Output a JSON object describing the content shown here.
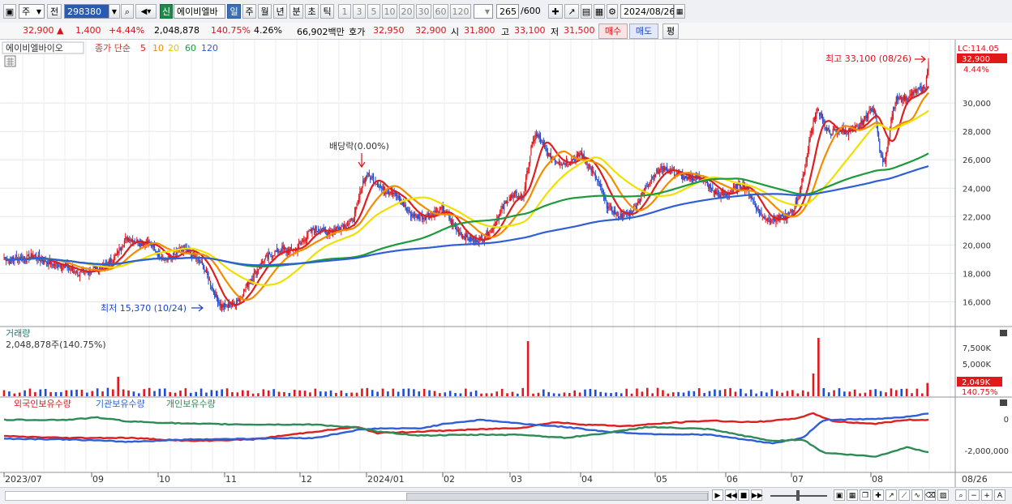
{
  "toolbar": {
    "period_type": "주",
    "prev_label": "전",
    "stock_code": "298380",
    "new_label": "신",
    "stock_name": "에이비엘바",
    "periods": [
      "일",
      "주",
      "월",
      "년",
      "분",
      "초",
      "틱"
    ],
    "intervals": [
      "1",
      "3",
      "5",
      "10",
      "20",
      "30",
      "60",
      "120"
    ],
    "count_value": "265",
    "count_total": "/600",
    "date": "2024/08/26"
  },
  "quote": {
    "price": "32,900",
    "arrow": "▲",
    "change": "1,400",
    "change_pct": "+4.44%",
    "volume": "2,048,878",
    "volume_pct": "140.75%",
    "turnover": "4.26%",
    "amount": "66,902백만",
    "bid_label": "호가",
    "ask_price": "32,950",
    "bid_price": "32,900",
    "open_label": "시",
    "open": "31,800",
    "high_label": "고",
    "high": "33,100",
    "low_label": "저",
    "low": "31,500",
    "buy_label": "매수",
    "sell_label": "매도",
    "eval_label": "평"
  },
  "price_panel": {
    "stock_label": "에이비엘바이오",
    "ma_title": "종가 단순",
    "ma_periods": [
      "5",
      "10",
      "20",
      "60",
      "120"
    ],
    "ma_colors": [
      "#dd1f1f",
      "#f28c00",
      "#f0e000",
      "#1e9a3c",
      "#2f5fd6"
    ],
    "lc_label": "LC:114.05",
    "price_tag": "32,900",
    "pct_tag": "4.44%",
    "y_ticks": [
      "30,000",
      "28,000",
      "26,000",
      "24,000",
      "22,000",
      "20,000",
      "18,000",
      "16,000"
    ],
    "high_annotation": "최고 33,100 (08/26)",
    "low_annotation": "최저 15,370 (10/24)",
    "dividend_annotation": "배당락(0.00%)"
  },
  "volume_panel": {
    "title": "거래량",
    "value": "2,048,878주(140.75%)",
    "y_ticks": [
      "7,500K",
      "5,000K"
    ],
    "tag_value": "2,049K",
    "tag_pct": "140.75%"
  },
  "holdings_panel": {
    "legend": [
      "외국인보유수량",
      "기관보유수량",
      "개인보유수량"
    ],
    "colors": [
      "#dd1f1f",
      "#2f5fd6",
      "#2e8b57"
    ],
    "y_ticks": [
      "0",
      "-2,000,000"
    ]
  },
  "x_axis": {
    "labels": [
      "2023/07",
      "09",
      "10",
      "11",
      "12",
      "2024/01",
      "02",
      "03",
      "04",
      "05",
      "06",
      "07",
      "08"
    ],
    "last_label": "08/26"
  },
  "chart_data": {
    "type": "candlestick",
    "title": "에이비엘바이오",
    "x_start": "2023/07",
    "x_end": "2024/08/26",
    "ylim": [
      14600,
      33600
    ],
    "last_close": 32900,
    "high": {
      "value": 33100,
      "date": "08/26"
    },
    "low": {
      "value": 15370,
      "date": "10/24"
    },
    "close_path": [
      [
        0,
        19100
      ],
      [
        6,
        18900
      ],
      [
        12,
        19100
      ],
      [
        20,
        19000
      ],
      [
        28,
        19300
      ],
      [
        34,
        19000
      ],
      [
        40,
        18900
      ],
      [
        48,
        18600
      ],
      [
        54,
        18600
      ],
      [
        60,
        18500
      ],
      [
        66,
        18200
      ],
      [
        72,
        18000
      ],
      [
        78,
        18100
      ],
      [
        84,
        18200
      ],
      [
        90,
        18300
      ],
      [
        96,
        18500
      ],
      [
        100,
        18700
      ],
      [
        104,
        18900
      ],
      [
        108,
        19300
      ],
      [
        112,
        19800
      ],
      [
        116,
        20300
      ],
      [
        120,
        20500
      ],
      [
        126,
        20300
      ],
      [
        132,
        20100
      ],
      [
        138,
        20300
      ],
      [
        144,
        19800
      ],
      [
        150,
        19300
      ],
      [
        156,
        19000
      ],
      [
        162,
        19200
      ],
      [
        168,
        19500
      ],
      [
        174,
        19700
      ],
      [
        180,
        19400
      ],
      [
        186,
        19000
      ],
      [
        192,
        18500
      ],
      [
        198,
        17500
      ],
      [
        202,
        16700
      ],
      [
        206,
        16100
      ],
      [
        210,
        15700
      ],
      [
        214,
        15700
      ],
      [
        220,
        15800
      ],
      [
        226,
        16200
      ],
      [
        232,
        16900
      ],
      [
        238,
        17600
      ],
      [
        244,
        18300
      ],
      [
        250,
        18900
      ],
      [
        256,
        19300
      ],
      [
        262,
        19500
      ],
      [
        268,
        19700
      ],
      [
        274,
        19600
      ],
      [
        280,
        19700
      ],
      [
        286,
        20100
      ],
      [
        292,
        20700
      ],
      [
        298,
        21100
      ],
      [
        304,
        21100
      ],
      [
        310,
        20900
      ],
      [
        316,
        21000
      ],
      [
        322,
        21200
      ],
      [
        328,
        21400
      ],
      [
        334,
        21500
      ],
      [
        338,
        22200
      ],
      [
        342,
        23300
      ],
      [
        346,
        24500
      ],
      [
        350,
        24900
      ],
      [
        354,
        24700
      ],
      [
        358,
        24500
      ],
      [
        362,
        24100
      ],
      [
        368,
        23800
      ],
      [
        374,
        23800
      ],
      [
        380,
        23300
      ],
      [
        386,
        22700
      ],
      [
        392,
        22200
      ],
      [
        398,
        22000
      ],
      [
        404,
        22000
      ],
      [
        410,
        22100
      ],
      [
        416,
        22300
      ],
      [
        422,
        22500
      ],
      [
        428,
        22000
      ],
      [
        434,
        21300
      ],
      [
        440,
        20800
      ],
      [
        446,
        20500
      ],
      [
        452,
        20300
      ],
      [
        458,
        20400
      ],
      [
        464,
        20600
      ],
      [
        470,
        21100
      ],
      [
        476,
        22000
      ],
      [
        482,
        22800
      ],
      [
        488,
        23400
      ],
      [
        494,
        23500
      ],
      [
        500,
        23400
      ],
      [
        504,
        25000
      ],
      [
        508,
        26800
      ],
      [
        512,
        27800
      ],
      [
        516,
        27500
      ],
      [
        520,
        26900
      ],
      [
        524,
        26400
      ],
      [
        528,
        26100
      ],
      [
        532,
        26000
      ],
      [
        538,
        25800
      ],
      [
        544,
        25900
      ],
      [
        550,
        26100
      ],
      [
        556,
        26400
      ],
      [
        562,
        25800
      ],
      [
        568,
        25000
      ],
      [
        574,
        24200
      ],
      [
        580,
        22900
      ],
      [
        586,
        22400
      ],
      [
        592,
        22100
      ],
      [
        598,
        22100
      ],
      [
        604,
        22300
      ],
      [
        610,
        22900
      ],
      [
        616,
        23700
      ],
      [
        622,
        24500
      ],
      [
        628,
        25100
      ],
      [
        634,
        25400
      ],
      [
        640,
        25300
      ],
      [
        646,
        25100
      ],
      [
        652,
        24900
      ],
      [
        658,
        24600
      ],
      [
        664,
        24700
      ],
      [
        670,
        24800
      ],
      [
        676,
        24400
      ],
      [
        682,
        23900
      ],
      [
        688,
        23600
      ],
      [
        694,
        23500
      ],
      [
        700,
        23700
      ],
      [
        706,
        24100
      ],
      [
        712,
        24300
      ],
      [
        718,
        23700
      ],
      [
        724,
        22800
      ],
      [
        730,
        22100
      ],
      [
        736,
        21800
      ],
      [
        742,
        21800
      ],
      [
        748,
        21900
      ],
      [
        754,
        22000
      ],
      [
        760,
        22400
      ],
      [
        766,
        23500
      ],
      [
        772,
        25400
      ],
      [
        776,
        27400
      ],
      [
        780,
        28600
      ],
      [
        784,
        29500
      ],
      [
        788,
        29100
      ],
      [
        792,
        28100
      ],
      [
        796,
        27900
      ],
      [
        800,
        28000
      ],
      [
        806,
        28100
      ],
      [
        812,
        28000
      ],
      [
        818,
        28100
      ],
      [
        824,
        28300
      ],
      [
        830,
        29000
      ],
      [
        836,
        29600
      ],
      [
        840,
        29300
      ],
      [
        844,
        26800
      ],
      [
        848,
        25800
      ],
      [
        852,
        27100
      ],
      [
        856,
        29200
      ],
      [
        860,
        30200
      ],
      [
        866,
        30300
      ],
      [
        872,
        30400
      ],
      [
        878,
        30800
      ],
      [
        884,
        30900
      ],
      [
        888,
        31200
      ],
      [
        891,
        32900
      ]
    ],
    "moving_averages": [
      {
        "name": "5",
        "period": 5
      },
      {
        "name": "10",
        "period": 10
      },
      {
        "name": "20",
        "period": 20
      },
      {
        "name": "60",
        "period": 60
      },
      {
        "name": "120",
        "period": 120
      }
    ],
    "volume_ylim": [
      0,
      10000000
    ],
    "volume_last": 2048878,
    "volume_spikes": [
      [
        108,
        3000000
      ],
      [
        506,
        8500000
      ],
      [
        783,
        9000000
      ],
      [
        779,
        3500000
      ]
    ],
    "holdings_ylim": [
      -3200000,
      1200000
    ],
    "holdings": [
      {
        "name": "외국인보유수량",
        "points": [
          [
            0,
            -1100000
          ],
          [
            60,
            -1200000
          ],
          [
            120,
            -1200000
          ],
          [
            180,
            -1400000
          ],
          [
            240,
            -1300000
          ],
          [
            300,
            -800000
          ],
          [
            340,
            -500000
          ],
          [
            360,
            -900000
          ],
          [
            400,
            -800000
          ],
          [
            460,
            -650000
          ],
          [
            500,
            -550000
          ],
          [
            530,
            -200000
          ],
          [
            560,
            -350000
          ],
          [
            600,
            -450000
          ],
          [
            640,
            -250000
          ],
          [
            680,
            -100000
          ],
          [
            720,
            -200000
          ],
          [
            760,
            0
          ],
          [
            780,
            350000
          ],
          [
            800,
            -150000
          ],
          [
            840,
            -300000
          ],
          [
            870,
            -50000
          ],
          [
            891,
            -50000
          ]
        ]
      },
      {
        "name": "기관보유수량",
        "points": [
          [
            0,
            -1250000
          ],
          [
            60,
            -1300000
          ],
          [
            120,
            -1450000
          ],
          [
            180,
            -1300000
          ],
          [
            240,
            -1250000
          ],
          [
            300,
            -1200000
          ],
          [
            340,
            -700000
          ],
          [
            360,
            -600000
          ],
          [
            400,
            -600000
          ],
          [
            430,
            -250000
          ],
          [
            460,
            -50000
          ],
          [
            500,
            -300000
          ],
          [
            540,
            -500000
          ],
          [
            580,
            -800000
          ],
          [
            620,
            -950000
          ],
          [
            680,
            -1000000
          ],
          [
            740,
            -1550000
          ],
          [
            770,
            -1200000
          ],
          [
            790,
            -50000
          ],
          [
            840,
            0
          ],
          [
            870,
            150000
          ],
          [
            891,
            350000
          ]
        ]
      },
      {
        "name": "개인보유수량",
        "points": [
          [
            0,
            -50000
          ],
          [
            60,
            -50000
          ],
          [
            90,
            100000
          ],
          [
            120,
            -150000
          ],
          [
            180,
            -300000
          ],
          [
            240,
            -350000
          ],
          [
            300,
            -350000
          ],
          [
            340,
            -550000
          ],
          [
            360,
            -800000
          ],
          [
            400,
            -1050000
          ],
          [
            460,
            -1000000
          ],
          [
            500,
            -1000000
          ],
          [
            540,
            -1200000
          ],
          [
            580,
            -900000
          ],
          [
            620,
            -500000
          ],
          [
            680,
            -650000
          ],
          [
            740,
            -1400000
          ],
          [
            770,
            -1300000
          ],
          [
            790,
            -2150000
          ],
          [
            840,
            -2400000
          ],
          [
            870,
            -1800000
          ],
          [
            891,
            -2100000
          ]
        ]
      }
    ]
  }
}
